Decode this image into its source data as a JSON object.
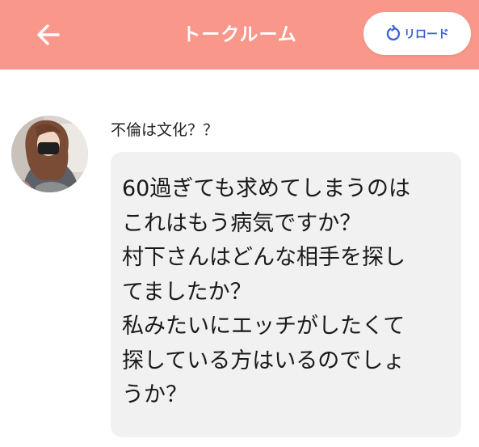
{
  "header": {
    "title": "トークルーム",
    "reload_label": "リロード",
    "background_color": "#f9978b",
    "accent_color": "#3a5fd8",
    "back_icon": "arrow-left-icon",
    "reload_icon": "refresh-icon"
  },
  "message": {
    "sender_name": "不倫は文化？？",
    "text": "60過ぎても求めてしまうのは\nこれはもう病気ですか？\n村下さんはどんな相手を探し\nてましたか？\n私みたいにエッチがしたくて\n探している方はいるのでしょ\nうか？",
    "avatar": "user-avatar-photo"
  }
}
